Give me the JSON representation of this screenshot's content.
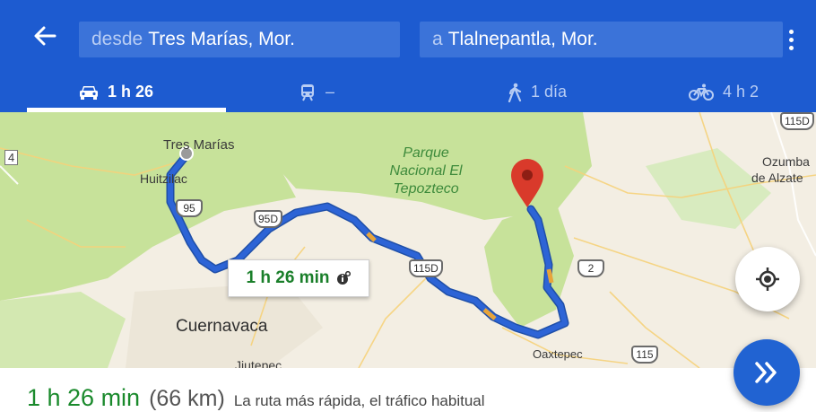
{
  "header": {
    "from_prefix": "desde",
    "from_value": "Tres Marías, Mor.",
    "to_prefix": "a",
    "to_value": "Tlalnepantla, Mor."
  },
  "tabs": [
    {
      "mode": "car",
      "icon": "car-icon",
      "label": "1 h 26",
      "selected": true
    },
    {
      "mode": "transit",
      "icon": "train-icon",
      "label": "–",
      "selected": false
    },
    {
      "mode": "walk",
      "icon": "walk-icon",
      "label": "1 día",
      "selected": false
    },
    {
      "mode": "bike",
      "icon": "bike-icon",
      "label": "4 h 2",
      "selected": false
    }
  ],
  "map": {
    "labels": {
      "tres_marias": "Tres Marías",
      "huitzilac": "Huitzilac",
      "parque": "Parque",
      "nacional": "Nacional El",
      "tepozteco": "Tepozteco",
      "ozumba": "Ozumba",
      "de_alzate": "de Alzate",
      "cuernavaca": "Cuernavaca",
      "jiutepec": "Jiutepec",
      "oaxtepec": "Oaxtepec",
      "left_edge": "4"
    },
    "shields": {
      "r95": "95",
      "r95d": "95D",
      "r115d": "115D",
      "r2": "2",
      "r115": "115",
      "r115d_top": "115D"
    },
    "route_bubble": "1 h 26 min"
  },
  "summary": {
    "duration": "1 h 26 min",
    "distance": "(66 km)",
    "description": "La ruta más rápida, el tráfico habitual"
  },
  "colors": {
    "header_bg": "#1d5bd0",
    "route": "#2d64d6",
    "park_green": "#c7e29a",
    "pin": "#d93a2b",
    "duration_green": "#1a8a2c"
  }
}
